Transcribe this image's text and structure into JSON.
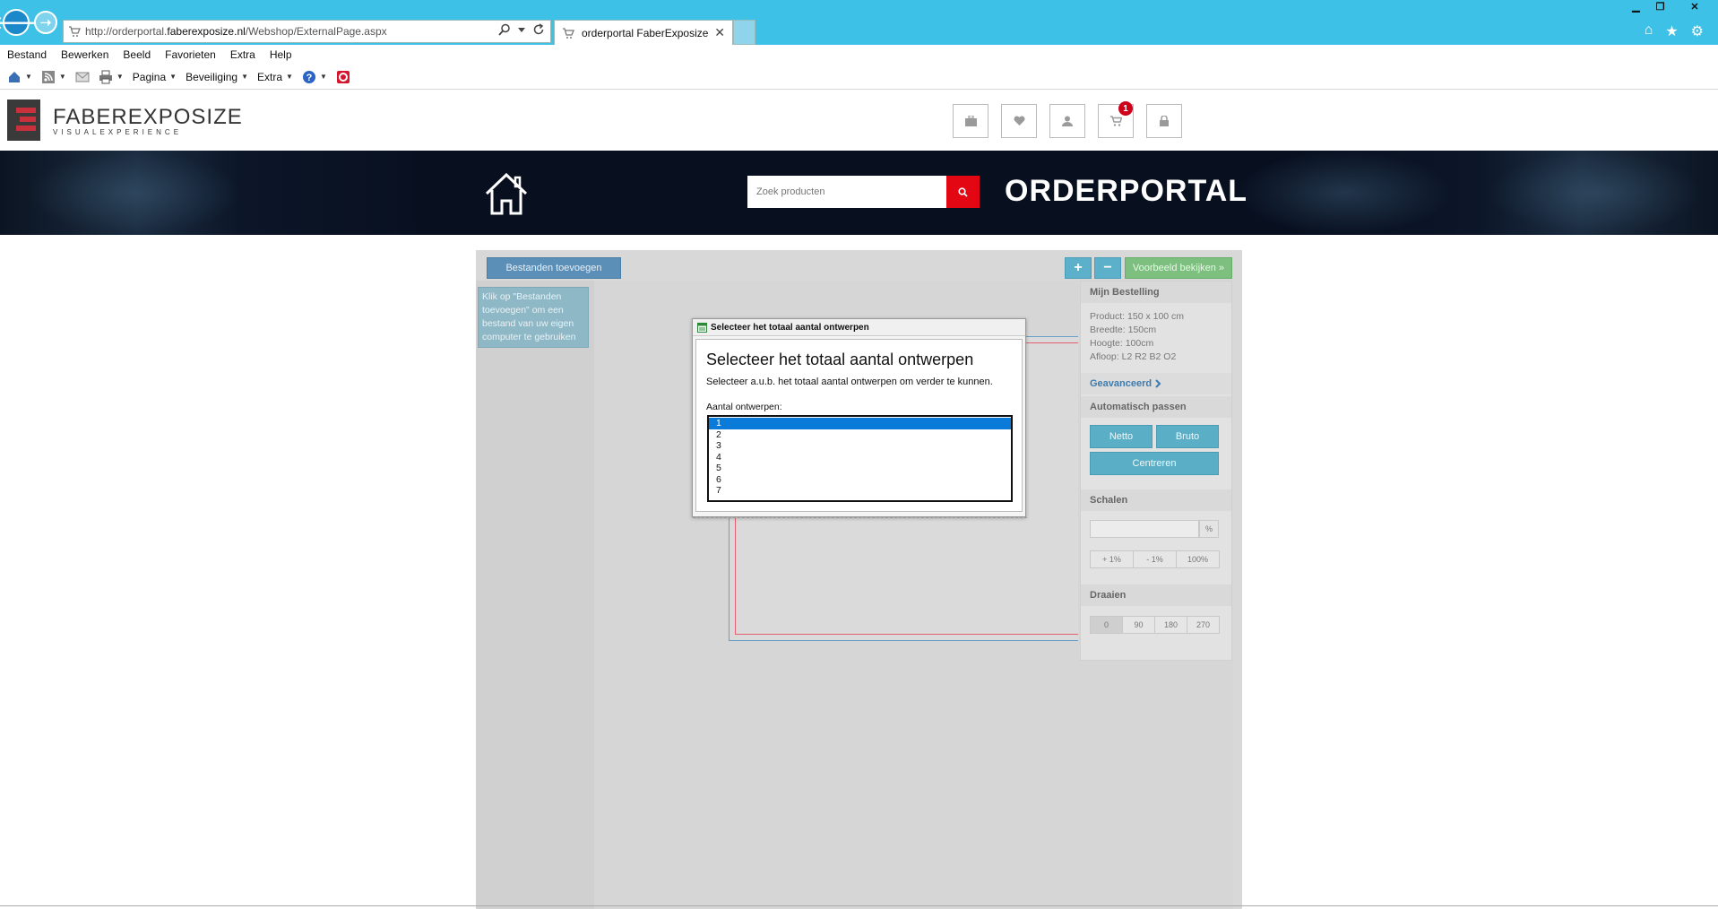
{
  "browser": {
    "url_prefix": "http://orderportal.",
    "url_domain": "faberexposize.nl",
    "url_path": "/Webshop/ExternalPage.aspx",
    "tab_title": "orderportal FaberExposize",
    "tab_close": "✕",
    "back_icon": "🡐",
    "forward_icon": "➝"
  },
  "menu": [
    "Bestand",
    "Bewerken",
    "Beeld",
    "Favorieten",
    "Extra",
    "Help"
  ],
  "commandbar": {
    "pagina": "Pagina",
    "beveiliging": "Beveiliging",
    "extra": "Extra"
  },
  "site": {
    "logo_name_bold": "FABER",
    "logo_name_light": "EXPOSIZE",
    "logo_sub": "VISUALEXPERIENCE",
    "cart_count": "1",
    "search_placeholder": "Zoek producten",
    "banner_title": "ORDERPORTAL"
  },
  "editor": {
    "add_files_label": "Bestanden toevoegen",
    "plus_label": "+",
    "minus_label": "−",
    "preview_label": "Voorbeeld bekijken »",
    "hint_text": "Klik op \"Bestanden toevoegen\" om een bestand van uw eigen computer te gebruiken"
  },
  "dialog": {
    "title": "Selecteer het totaal aantal ontwerpen",
    "heading": "Selecteer het totaal aantal ontwerpen",
    "description": "Selecteer a.u.b. het totaal aantal ontwerpen om verder te kunnen.",
    "label": "Aantal ontwerpen:",
    "options": [
      "1",
      "2",
      "3",
      "4",
      "5",
      "6",
      "7"
    ],
    "selected": "1"
  },
  "order": {
    "title": "Mijn Bestelling",
    "product": "Product: 150 x 100 cm",
    "width": "Breedte: 150cm",
    "height": "Hoogte: 100cm",
    "bleed": "Afloop:  L2 R2 B2 O2",
    "advanced": "Geavanceerd",
    "auto_fit_title": "Automatisch passen",
    "netto": "Netto",
    "bruto": "Bruto",
    "center": "Centreren",
    "scale_title": "Schalen",
    "scale_value": "",
    "percent": "%",
    "scale_buttons": [
      "+ 1%",
      "- 1%",
      "100%"
    ],
    "rotate_title": "Draaien",
    "rotate_buttons": [
      "0",
      "90",
      "180",
      "270"
    ]
  }
}
